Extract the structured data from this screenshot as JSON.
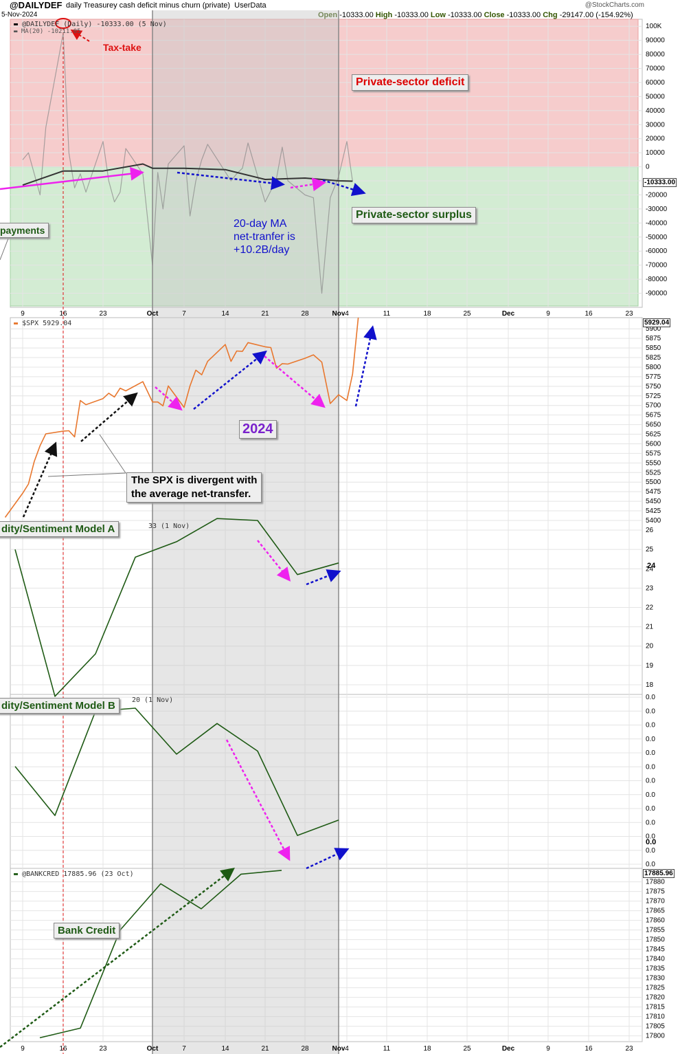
{
  "header": {
    "symbol": "@DAILYDEF",
    "description": "daily Treasurey cash deficit minus churn (private)",
    "source": "UserData",
    "credit": "@StockCharts.com",
    "date": "5-Nov-2024",
    "open_label": "Open",
    "open": "-10333.00",
    "high_label": "High",
    "high": "-10333.00",
    "low_label": "Low",
    "low": "-10333.00",
    "close_label": "Close",
    "close": "-10333.00",
    "chg_label": "Chg",
    "chg": "-29147.00 (-154.92%)"
  },
  "annotations": {
    "tax_take": "Tax-take",
    "deficit": "Private-sector deficit",
    "surplus": "Private-sector surplus",
    "ma_note_1": "20-day MA",
    "ma_note_2": "net-tranfer is",
    "ma_note_3": "+10.2B/day",
    "payments": "payments",
    "year": "2024",
    "divergent_1": "The SPX is divergent with",
    "divergent_2": "the average net-transfer.",
    "model_a": "dity/Sentiment Model A",
    "model_b": "dity/Sentiment Model B",
    "bank_credit": "Bank Credit"
  },
  "colors": {
    "deficit_fill": "#f6cccc",
    "surplus_fill": "#d3ecd3",
    "shade": "#c8c8c8",
    "spx_line": "#e8772e",
    "model_line": "#1e5a14",
    "magenta": "#ee22ee",
    "blue_arrow": "#1111cc",
    "tax_red": "#dd1111"
  },
  "chart_data": [
    {
      "type": "line",
      "title": "@DAILYDEF daily Treasurey cash deficit minus churn (private)",
      "legend": [
        {
          "name": "@DAILYDEF (Daily) -10333.00 (5 Nov)"
        },
        {
          "name": "MA(20) -10211.05"
        }
      ],
      "last_value": "-10333.00",
      "ylim": [
        -100000,
        105000
      ],
      "yticks": [
        "100K",
        "90000",
        "80000",
        "70000",
        "60000",
        "50000",
        "40000",
        "30000",
        "20000",
        "10000",
        "0",
        "-10000",
        "-20000",
        "-30000",
        "-40000",
        "-50000",
        "-60000",
        "-70000",
        "-80000",
        "-90000"
      ],
      "series": [
        {
          "name": "@DAILYDEF",
          "x": [
            "2024-09-09",
            "2024-09-10",
            "2024-09-11",
            "2024-09-12",
            "2024-09-13",
            "2024-09-16",
            "2024-09-17",
            "2024-09-18",
            "2024-09-19",
            "2024-09-20",
            "2024-09-23",
            "2024-09-24",
            "2024-09-25",
            "2024-09-26",
            "2024-09-27",
            "2024-09-30",
            "2024-10-01",
            "2024-10-02",
            "2024-10-03",
            "2024-10-04",
            "2024-10-07",
            "2024-10-08",
            "2024-10-09",
            "2024-10-10",
            "2024-10-11",
            "2024-10-15",
            "2024-10-16",
            "2024-10-17",
            "2024-10-18",
            "2024-10-21",
            "2024-10-22",
            "2024-10-23",
            "2024-10-24",
            "2024-10-25",
            "2024-10-28",
            "2024-10-29",
            "2024-10-30",
            "2024-10-31",
            "2024-11-01",
            "2024-11-04",
            "2024-11-05"
          ],
          "values": [
            5000,
            10000,
            -5000,
            -20000,
            28000,
            95000,
            10000,
            -15000,
            -5000,
            -18000,
            18000,
            -10000,
            -25000,
            -18000,
            13000,
            -5000,
            -70000,
            -4000,
            -30000,
            2000,
            15000,
            -35000,
            -10000,
            5000,
            16000,
            -10000,
            -5000,
            -1000,
            17000,
            -25000,
            -17000,
            -8000,
            14000,
            -10000,
            -20000,
            -22000,
            -90000,
            -22000,
            -7000,
            18000,
            -10333
          ]
        },
        {
          "name": "MA(20)",
          "x": [
            "2024-09-09",
            "2024-09-16",
            "2024-09-20",
            "2024-09-23",
            "2024-09-30",
            "2024-10-01",
            "2024-10-07",
            "2024-10-14",
            "2024-10-21",
            "2024-10-28",
            "2024-11-01",
            "2024-11-05"
          ],
          "values": [
            -13000,
            -3000,
            -3000,
            -3000,
            2000,
            -1000,
            -1000,
            -2000,
            -9000,
            -8000,
            -10000,
            -10211
          ]
        }
      ]
    },
    {
      "type": "line",
      "title": "$SPX 5929.04",
      "last_value": "5929.04",
      "ylim": [
        5400,
        5929.04
      ],
      "yticks": [
        "5900",
        "5875",
        "5850",
        "5825",
        "5800",
        "5775",
        "5750",
        "5725",
        "5700",
        "5675",
        "5650",
        "5625",
        "5600",
        "5575",
        "5550",
        "5525",
        "5500",
        "5475",
        "5450",
        "5425",
        "5400"
      ],
      "series": [
        {
          "name": "$SPX",
          "x": [
            "2024-09-06",
            "2024-09-09",
            "2024-09-10",
            "2024-09-11",
            "2024-09-12",
            "2024-09-13",
            "2024-09-16",
            "2024-09-17",
            "2024-09-18",
            "2024-09-19",
            "2024-09-20",
            "2024-09-23",
            "2024-09-24",
            "2024-09-25",
            "2024-09-26",
            "2024-09-27",
            "2024-09-30",
            "2024-10-01",
            "2024-10-02",
            "2024-10-03",
            "2024-10-04",
            "2024-10-07",
            "2024-10-08",
            "2024-10-09",
            "2024-10-10",
            "2024-10-11",
            "2024-10-14",
            "2024-10-15",
            "2024-10-16",
            "2024-10-17",
            "2024-10-18",
            "2024-10-21",
            "2024-10-22",
            "2024-10-23",
            "2024-10-24",
            "2024-10-25",
            "2024-10-28",
            "2024-10-29",
            "2024-10-30",
            "2024-10-31",
            "2024-11-01",
            "2024-11-04",
            "2024-11-05",
            "2024-11-06"
          ],
          "values": [
            5408,
            5471,
            5495,
            5554,
            5595,
            5626,
            5633,
            5634,
            5618,
            5713,
            5702,
            5718,
            5732,
            5722,
            5745,
            5738,
            5762,
            5709,
            5709,
            5699,
            5751,
            5695,
            5751,
            5792,
            5780,
            5815,
            5859,
            5815,
            5842,
            5841,
            5864,
            5853,
            5851,
            5797,
            5809,
            5808,
            5823,
            5832,
            5813,
            5705,
            5728,
            5713,
            5782,
            5929
          ]
        }
      ]
    },
    {
      "type": "line",
      "title": "Liquidity/Sentiment Model A",
      "legend_fragment": "33 (1 Nov)",
      "ylim": [
        17.5,
        26.5
      ],
      "yticks": [
        "26",
        "25",
        "24",
        "23",
        "22",
        "21",
        "20",
        "19",
        "18"
      ],
      "last_value": "24",
      "series": [
        {
          "name": "Model A",
          "x": [
            "2024-09-06",
            "2024-09-13",
            "2024-09-20",
            "2024-09-27",
            "2024-10-04",
            "2024-10-11",
            "2024-10-18",
            "2024-10-25",
            "2024-11-01"
          ],
          "values": [
            25.0,
            17.4,
            19.6,
            24.6,
            25.4,
            26.6,
            26.5,
            23.7,
            24.3
          ]
        }
      ]
    },
    {
      "type": "line",
      "title": "Liquidity/Sentiment Model B",
      "legend_fragment": "20 (1 Nov)",
      "yticks": [
        "0.0",
        "0.0",
        "0.0",
        "0.0",
        "0.0",
        "0.0",
        "0.0",
        "0.0",
        "0.0",
        "0.0",
        "0.0",
        "0.0",
        "0.0"
      ],
      "last_value": "0.0",
      "series": [
        {
          "name": "Model B",
          "x": [
            "2024-09-06",
            "2024-09-13",
            "2024-09-20",
            "2024-09-27",
            "2024-10-04",
            "2024-10-11",
            "2024-10-18",
            "2024-10-25",
            "2024-11-01"
          ],
          "values": [
            0.62,
            0.3,
            0.98,
            1.0,
            0.7,
            0.9,
            0.72,
            0.17,
            0.27
          ]
        }
      ]
    },
    {
      "type": "line",
      "title": "@BANKCRED 17885.96 (23 Oct)",
      "last_value": "17885.96",
      "ylim": [
        17797,
        17887
      ],
      "yticks": [
        "17880",
        "17875",
        "17870",
        "17865",
        "17860",
        "17855",
        "17850",
        "17845",
        "17840",
        "17835",
        "17830",
        "17825",
        "17820",
        "17815",
        "17810",
        "17805",
        "17800"
      ],
      "series": [
        {
          "name": "@BANKCRED",
          "x": [
            "2024-09-11",
            "2024-09-18",
            "2024-09-25",
            "2024-10-02",
            "2024-10-09",
            "2024-10-16",
            "2024-10-23"
          ],
          "values": [
            17799,
            17804,
            17855,
            17879,
            17866,
            17884,
            17885.96
          ]
        }
      ]
    }
  ],
  "x_axis": {
    "labels": [
      "9",
      "16",
      "23",
      "Oct",
      "7",
      "14",
      "21",
      "28",
      "Nov",
      "4",
      "11",
      "18",
      "25",
      "Dec",
      "9",
      "16",
      "23"
    ]
  }
}
